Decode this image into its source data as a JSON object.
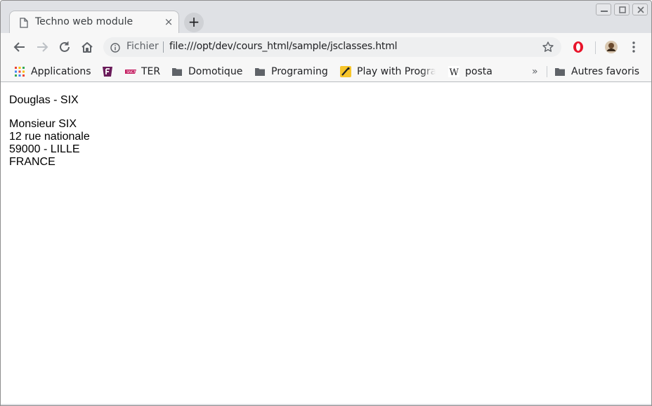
{
  "browser": {
    "tab": {
      "title": "Techno web module"
    },
    "new_tab_label": "+",
    "close_tab_label": "×",
    "omnibox": {
      "scheme_label": "Fichier",
      "url": "file:///opt/dev/cours_html/sample/jsclasses.html"
    },
    "bookmarks": {
      "items": [
        {
          "label": "Applications",
          "icon": "apps-grid-icon"
        },
        {
          "label": "",
          "icon": "f-logo-icon"
        },
        {
          "label": "TER",
          "icon": "sncf-icon"
        },
        {
          "label": "Domotique",
          "icon": "folder-icon"
        },
        {
          "label": "Programing",
          "icon": "folder-icon"
        },
        {
          "label": "Play with Progra",
          "icon": "play-icon"
        },
        {
          "label": "posta",
          "icon": "wikipedia-icon"
        }
      ],
      "overflow_label": "»",
      "other_label": "Autres favoris"
    },
    "colors": {
      "tabstrip": "#dfe1e5",
      "toolbar": "#f7f7f7",
      "opera_red": "#e8142a"
    }
  },
  "page": {
    "name_line": "Douglas - SIX",
    "address": {
      "line1": "Monsieur SIX",
      "line2": "12 rue nationale",
      "line3": "59000 - LILLE",
      "line4": "FRANCE"
    }
  }
}
